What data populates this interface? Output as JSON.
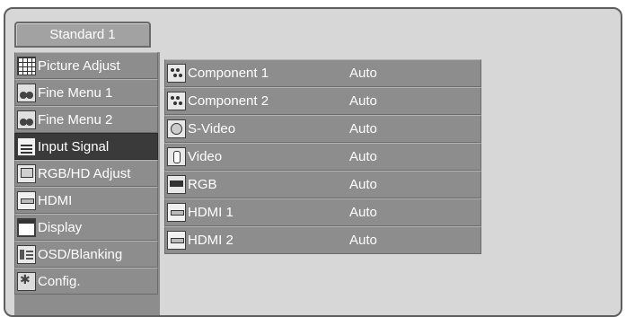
{
  "title": "Standard 1",
  "sidebar": {
    "items": [
      {
        "label": "Picture Adjust",
        "icon": "grid-icon"
      },
      {
        "label": "Fine Menu 1",
        "icon": "fine-menu-icon"
      },
      {
        "label": "Fine Menu 2",
        "icon": "fine-menu-icon"
      },
      {
        "label": "Input Signal",
        "icon": "input-signal-icon",
        "active": true
      },
      {
        "label": "RGB/HD Adjust",
        "icon": "monitor-icon"
      },
      {
        "label": "HDMI",
        "icon": "hdmi-icon"
      },
      {
        "label": "Display",
        "icon": "display-icon"
      },
      {
        "label": "OSD/Blanking",
        "icon": "osd-icon"
      },
      {
        "label": "Config.",
        "icon": "config-icon"
      }
    ]
  },
  "inputs": [
    {
      "label": "Component 1",
      "value": "Auto",
      "icon": "component-icon"
    },
    {
      "label": "Component 2",
      "value": "Auto",
      "icon": "component-icon"
    },
    {
      "label": "S-Video",
      "value": "Auto",
      "icon": "s-video-icon"
    },
    {
      "label": "Video",
      "value": "Auto",
      "icon": "video-icon"
    },
    {
      "label": "RGB",
      "value": "Auto",
      "icon": "rgb-icon"
    },
    {
      "label": "HDMI 1",
      "value": "Auto",
      "icon": "hdmi-icon"
    },
    {
      "label": "HDMI 2",
      "value": "Auto",
      "icon": "hdmi-icon"
    }
  ],
  "colors": {
    "panel_background": "#d7d7d7",
    "item_background": "#8d8d8d",
    "active_item": "#3a3a3a",
    "text": "#ffffff"
  }
}
